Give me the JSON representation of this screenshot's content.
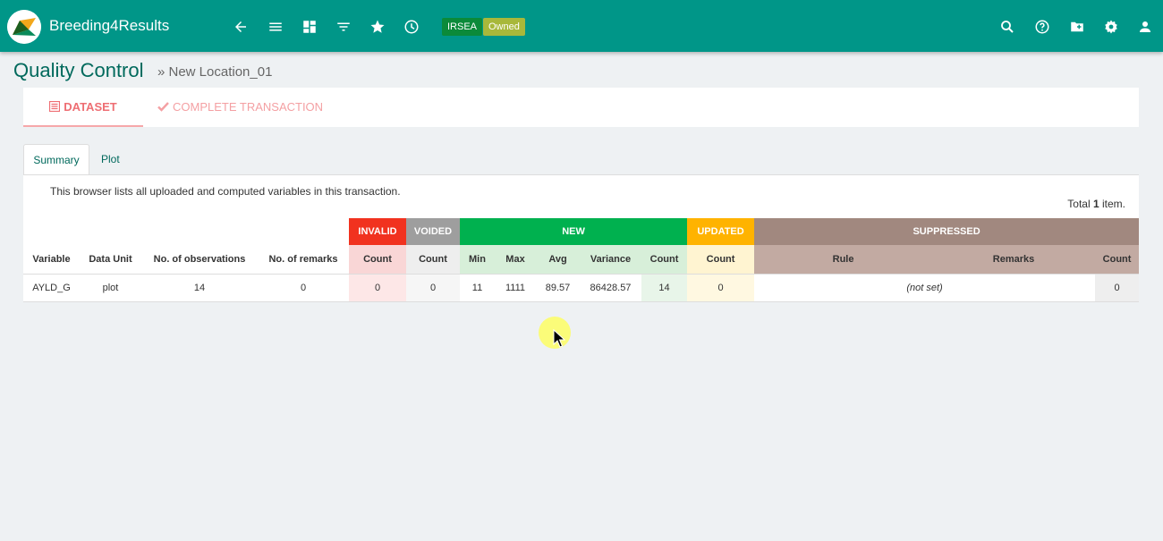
{
  "app": {
    "name": "Breeding4Results"
  },
  "badges": {
    "program": "IRSEA",
    "ownership": "Owned"
  },
  "header": {
    "title": "Quality Control",
    "breadcrumb": "» New Location_01"
  },
  "main_tabs": [
    {
      "label": "DATASET",
      "icon": "list-alt-icon",
      "active": true
    },
    {
      "label": "COMPLETE TRANSACTION",
      "icon": "check-icon",
      "active": false
    }
  ],
  "sub_tabs": [
    {
      "label": "Summary",
      "active": true
    },
    {
      "label": "Plot",
      "active": false
    }
  ],
  "summary": {
    "description": "This browser lists all uploaded and computed variables in this transaction.",
    "total_prefix": "Total ",
    "total_count": "1",
    "total_suffix": " item."
  },
  "table": {
    "groups": {
      "invalid": "INVALID",
      "voided": "VOIDED",
      "new": "NEW",
      "updated": "UPDATED",
      "suppressed": "SUPPRESSED"
    },
    "columns": {
      "variable": "Variable",
      "data_unit": "Data Unit",
      "observations": "No. of observations",
      "remarks": "No. of remarks",
      "invalid_count": "Count",
      "voided_count": "Count",
      "new_min": "Min",
      "new_max": "Max",
      "new_avg": "Avg",
      "new_variance": "Variance",
      "new_count": "Count",
      "updated_count": "Count",
      "supp_rule": "Rule",
      "supp_remarks": "Remarks",
      "supp_count": "Count"
    },
    "rows": [
      {
        "variable": "AYLD_G",
        "data_unit": "plot",
        "observations": "14",
        "remarks": "0",
        "invalid_count": "0",
        "voided_count": "0",
        "new_min": "11",
        "new_max": "1111",
        "new_avg": "89.57",
        "new_variance": "86428.57",
        "new_count": "14",
        "updated_count": "0",
        "supp_rule_remarks": "(not set)",
        "supp_count": "0"
      }
    ]
  },
  "colors": {
    "topbar": "#009688",
    "invalid": "#f1321f",
    "voided": "#9e9e9e",
    "new": "#00b14f",
    "updated": "#ffb300",
    "suppressed": "#a1887f",
    "accent": "#ee6e73"
  }
}
